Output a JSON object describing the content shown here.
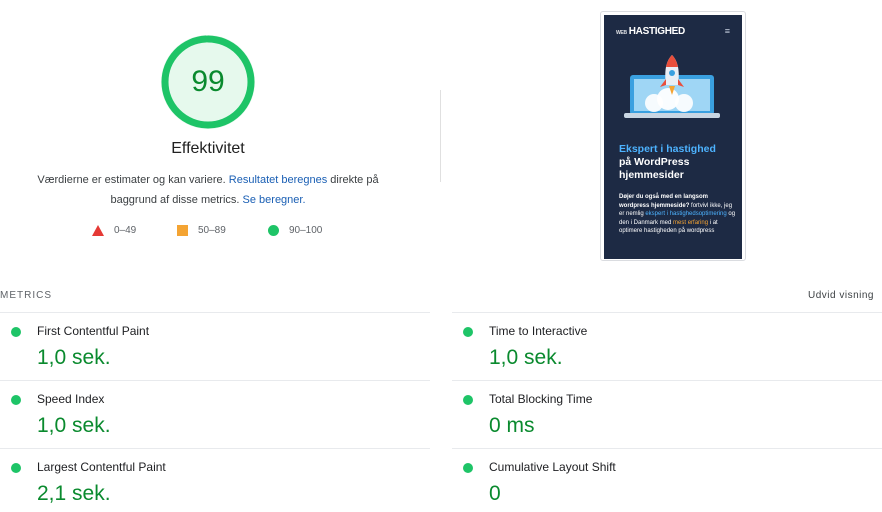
{
  "summary": {
    "score": "99",
    "score_fraction": 0.99,
    "title": "Effektivitet",
    "desc_text1": "Værdierne er estimater og kan variere. ",
    "desc_link1": "Resultatet beregnes",
    "desc_text2": " direkte på baggrund af disse metrics. ",
    "desc_link2": "Se beregner.",
    "colors": {
      "pass": "#1ec467",
      "score_text": "#0a8a2e",
      "fail": "#e53935",
      "average": "#f4a433"
    }
  },
  "legend": [
    {
      "icon": "triangle-icon",
      "range": "0–49"
    },
    {
      "icon": "square-icon",
      "range": "50–89"
    },
    {
      "icon": "circle-icon",
      "range": "90–100"
    }
  ],
  "screenshot": {
    "logo_small": "WEB",
    "logo": "HASTIGHED",
    "menu_icon": "menu-icon",
    "headline_line1": "Ekspert i hastighed",
    "headline_line2": "på WordPress",
    "headline_line3": "hjemmesider",
    "body_bold": "Døjer du også med en langsom wordpress hjemmeside?",
    "body_1": " fortvivl ikke, jeg er nemlig ",
    "body_link1": "ekspert i hastighedsoptimering",
    "body_2": " og den i Danmark med ",
    "body_link2": "mest erfaring",
    "body_3": " i at optimere hastigheden på wordpress"
  },
  "metrics": {
    "section_label": "METRICS",
    "expand_label": "Udvid visning",
    "items": [
      {
        "label": "First Contentful Paint",
        "value": "1,0 sek."
      },
      {
        "label": "Time to Interactive",
        "value": "1,0 sek."
      },
      {
        "label": "Speed Index",
        "value": "1,0 sek."
      },
      {
        "label": "Total Blocking Time",
        "value": "0 ms"
      },
      {
        "label": "Largest Contentful Paint",
        "value": "2,1 sek."
      },
      {
        "label": "Cumulative Layout Shift",
        "value": "0"
      }
    ]
  }
}
